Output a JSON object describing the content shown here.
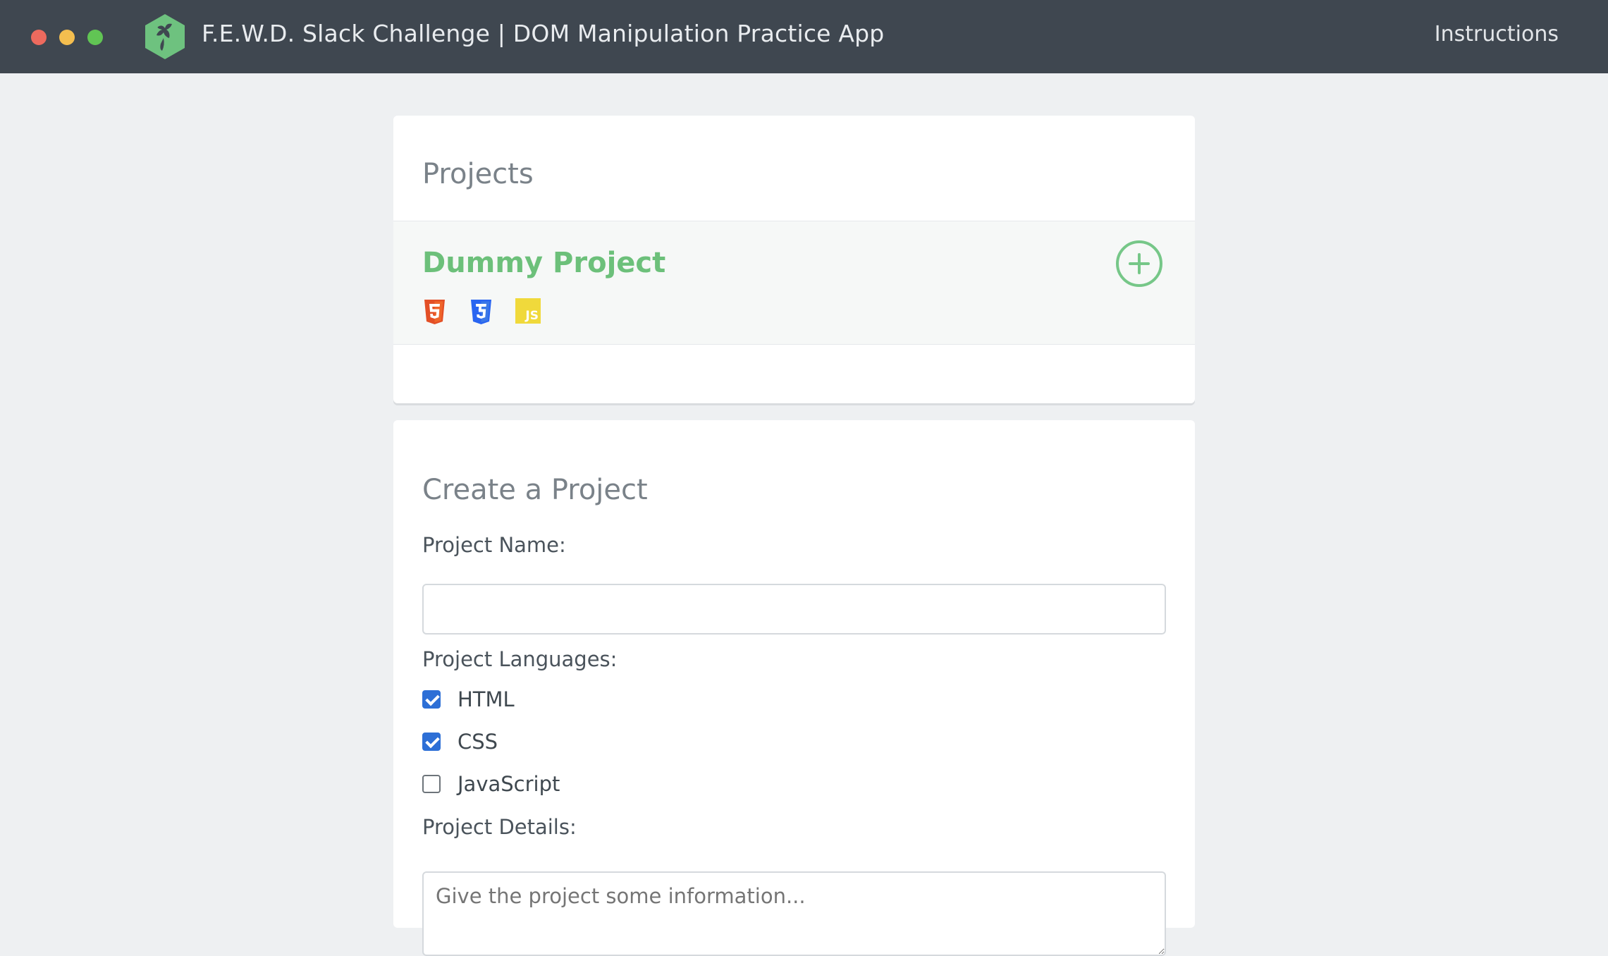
{
  "window": {
    "title": "F.E.W.D. Slack Challenge | DOM Manipulation Practice App",
    "nav_link": "Instructions"
  },
  "colors": {
    "header_bg": "#3f4750",
    "page_bg": "#eef0f2",
    "accent_green": "#6cc07a",
    "checkbox_blue": "#2d6fd6",
    "html5_orange": "#e34f26",
    "css3_blue": "#2965f1",
    "js_yellow": "#f0d93b"
  },
  "projects": {
    "heading": "Projects",
    "items": [
      {
        "name": "Dummy Project",
        "languages": [
          "html5-icon",
          "css3-icon",
          "javascript-icon"
        ],
        "js_badge_text": "JS"
      }
    ]
  },
  "create_form": {
    "heading": "Create a Project",
    "name_label": "Project Name:",
    "name_value": "",
    "languages_label": "Project Languages:",
    "languages": [
      {
        "label": "HTML",
        "checked": true
      },
      {
        "label": "CSS",
        "checked": true
      },
      {
        "label": "JavaScript",
        "checked": false
      }
    ],
    "details_label": "Project Details:",
    "details_placeholder": "Give the project some information..."
  }
}
